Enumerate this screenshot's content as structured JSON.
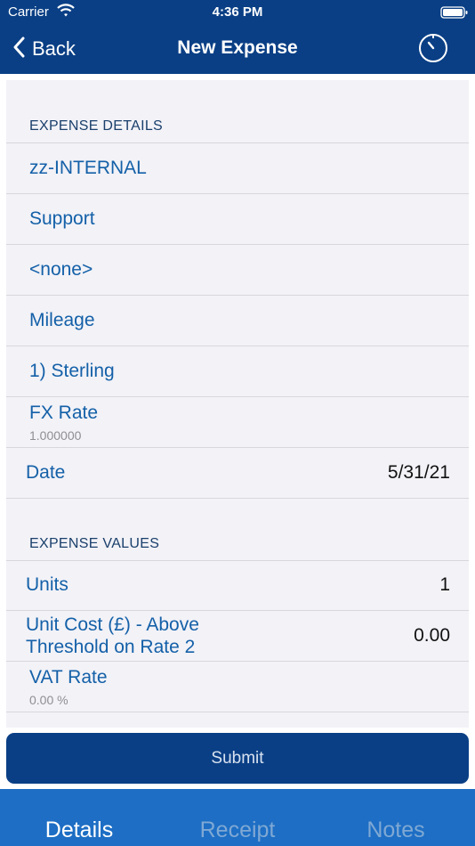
{
  "status_bar": {
    "carrier": "Carrier",
    "time": "4:36 PM"
  },
  "nav": {
    "back_label": "Back",
    "title": "New Expense"
  },
  "expense_details": {
    "header": "EXPENSE DETAILS",
    "items": [
      {
        "label": "zz-INTERNAL"
      },
      {
        "label": "Support"
      },
      {
        "label": "<none>"
      },
      {
        "label": "Mileage"
      },
      {
        "label": "1) Sterling"
      }
    ],
    "fx_rate": {
      "label": "FX Rate",
      "value": "1.000000"
    },
    "date": {
      "label": "Date",
      "value": "5/31/21"
    }
  },
  "expense_values": {
    "header": "EXPENSE VALUES",
    "units": {
      "label": "Units",
      "value": "1"
    },
    "unit_cost": {
      "label_line1": "Unit Cost (£) - Above",
      "label_line2": "Threshold on Rate 2",
      "value": "0.00"
    },
    "vat_rate": {
      "label": "VAT Rate",
      "value": "0.00 %"
    }
  },
  "submit_label": "Submit",
  "tabs": [
    {
      "label": "Details",
      "active": true
    },
    {
      "label": "Receipt",
      "active": false
    },
    {
      "label": "Notes",
      "active": false
    }
  ],
  "colors": {
    "nav_blue": "#0a3f85",
    "tab_blue": "#1d6ec4",
    "link_blue": "#1460a8"
  }
}
